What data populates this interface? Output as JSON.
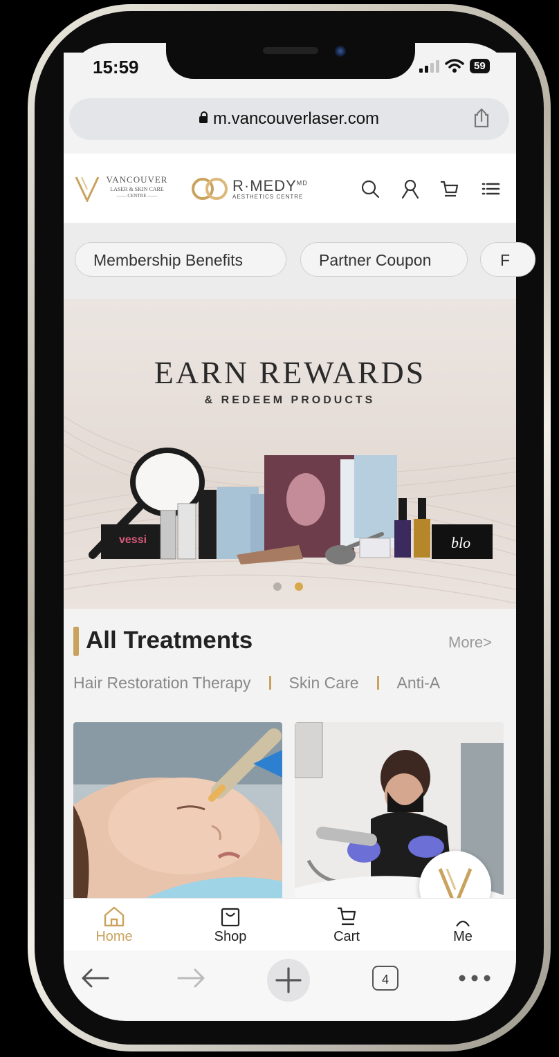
{
  "status_bar": {
    "time": "15:59",
    "battery": "59"
  },
  "browser": {
    "url": "m.vancouverlaser.com",
    "tab_count": "4"
  },
  "header": {
    "logo1_line1": "VANCOUVER",
    "logo1_line2": "LASER & SKIN CARE",
    "logo1_line3": "CENTRE",
    "logo2_main": "R·MEDY",
    "logo2_sup": "MD",
    "logo2_sub": "AESTHETICS CENTRE",
    "icons": [
      "search-icon",
      "user-icon",
      "cart-icon",
      "menu-icon"
    ]
  },
  "chips": [
    "Membership Benefits",
    "Partner Coupon",
    "F"
  ],
  "banner": {
    "title": "EARN REWARDS",
    "subtitle": "& REDEEM PRODUCTS",
    "slide_count": 2,
    "active_slide": 2
  },
  "treatments": {
    "title": "All Treatments",
    "more": "More>",
    "categories": [
      "Hair Restoration Therapy",
      "Skin Care",
      "Anti-A"
    ]
  },
  "bottom_nav": {
    "home": "Home",
    "shop": "Shop",
    "cart": "Cart",
    "me": "Me"
  },
  "colors": {
    "accent": "#c9a35d",
    "background": "#f3f3f3"
  }
}
